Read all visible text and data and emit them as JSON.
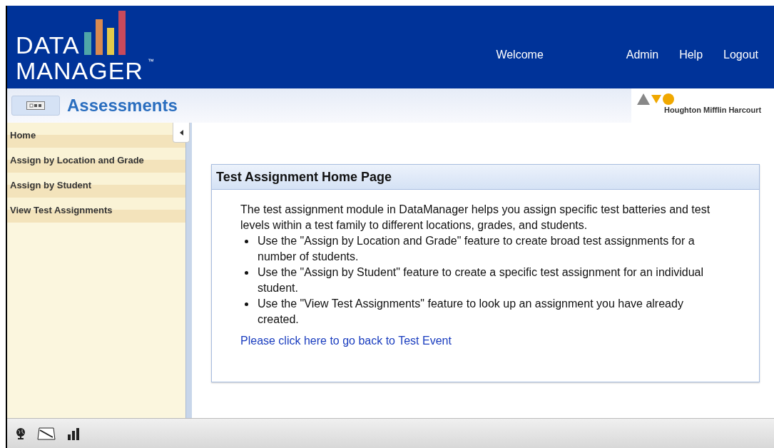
{
  "header": {
    "logo": {
      "line1": "DATA",
      "line2": "MANAGER",
      "mark": "™"
    },
    "nav": [
      "Welcome",
      "Admin",
      "Help",
      "Logout"
    ]
  },
  "subheader": {
    "title": "Assessments",
    "brand": "Houghton Mifflin Harcourt"
  },
  "sidebar": {
    "items": [
      "Home",
      "Assign by Location and Grade",
      "Assign by Student",
      "View Test Assignments"
    ]
  },
  "panel": {
    "title": "Test Assignment Home Page",
    "intro": "The test assignment module in DataManager helps you assign specific test batteries and test levels within a test family to different locations, grades, and students.",
    "bullets": [
      "Use the \"Assign by Location and Grade\" feature to create broad test assignments for a number of students.",
      "Use the \"Assign by Student\" feature to create a specific test assignment for an individual student.",
      "Use the \"View Test Assignments\" feature to look up an assignment you have already created."
    ],
    "link": "Please click here to go back to Test Event"
  }
}
